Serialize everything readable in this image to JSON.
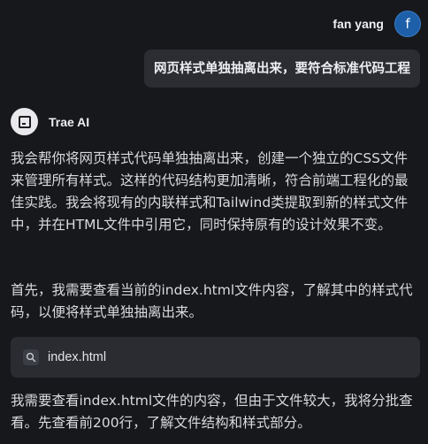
{
  "user": {
    "name": "fan yang",
    "avatar_letter": "f",
    "message": "网页样式单独抽离出来，要符合标准代码工程"
  },
  "assistant": {
    "name": "Trae AI",
    "paragraph1": "我会帮你将网页样式代码单独抽离出来，创建一个独立的CSS文件来管理所有样式。这样的代码结构更加清晰，符合前端工程化的最佳实践。我会将现有的内联样式和Tailwind类提取到新的样式文件中，并在HTML文件中引用它，同时保持原有的设计效果不变。",
    "paragraph2": "首先，我需要查看当前的index.html文件内容，了解其中的样式代码，以便将样式单独抽离出来。",
    "file_card": {
      "icon": "search-icon",
      "filename": "index.html"
    },
    "paragraph3": "我需要查看index.html文件的内容，但由于文件较大，我将分批查看。先查看前200行，了解文件结构和样式部分。"
  }
}
